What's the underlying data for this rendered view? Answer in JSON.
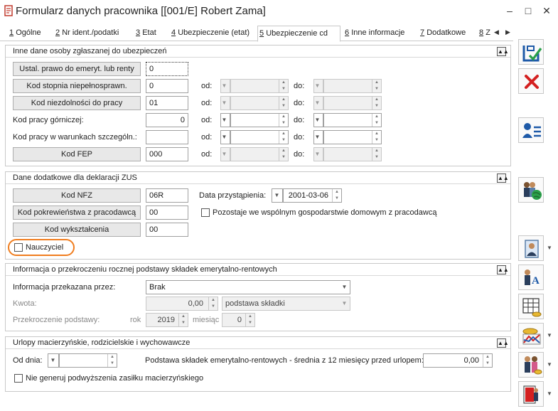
{
  "window": {
    "title": "Formularz danych pracownika [[001/E] Robert Zama]",
    "minimize": "–",
    "maximize": "□",
    "close": "✕"
  },
  "tabs": [
    {
      "num": "1",
      "label": "Ogólne"
    },
    {
      "num": "2",
      "label": "Nr ident./podatki"
    },
    {
      "num": "3",
      "label": "Etat"
    },
    {
      "num": "4",
      "label": "Ubezpieczenie (etat)"
    },
    {
      "num": "5",
      "label": "Ubezpieczenie cd"
    },
    {
      "num": "6",
      "label": "Inne informacje"
    },
    {
      "num": "7",
      "label": "Dodatkowe"
    },
    {
      "num": "8",
      "label": "Z"
    }
  ],
  "section1": {
    "title": "Inne dane osoby zgłaszanej do ubezpieczeń",
    "emeryt_button": "Ustal. prawo do emeryt. lub renty",
    "emeryt_value": "0",
    "niepelnospr_button": "Kod stopnia niepełnosprawn.",
    "niepelnospr_value": "0",
    "niezdolnosc_button": "Kod niezdolności do pracy",
    "niezdolnosc_value": "01",
    "gornicza_label": "Kod pracy górniczej:",
    "gornicza_value": "0",
    "szczegolne_label": "Kod pracy w warunkach szczególn.:",
    "szczegolne_value": "",
    "fep_button": "Kod FEP",
    "fep_value": "000",
    "od": "od:",
    "do": "do:"
  },
  "section2": {
    "title": "Dane dodatkowe dla deklaracji ZUS",
    "nfz_button": "Kod NFZ",
    "nfz_value": "06R",
    "data_label": "Data przystąpienia:",
    "data_value": "2001-03-06",
    "pokrew_button": "Kod pokrewieństwa z pracodawcą",
    "pokrew_value": "00",
    "gosp_label": "Pozostaje we wspólnym gospodarstwie domowym z pracodawcą",
    "wykszt_button": "Kod wykształcenia",
    "wykszt_value": "00",
    "nauczyciel_label": "Nauczyciel"
  },
  "section3": {
    "title": "Informacja o przekroczeniu rocznej podstawy składek emerytalno-rentowych",
    "info_label": "Informacja przekazana przez:",
    "info_value": "Brak",
    "kwota_label": "Kwota:",
    "kwota_value": "0,00",
    "kwota_type": "podstawa składki",
    "przekr_label": "Przekroczenie podstawy:",
    "rok_label": "rok",
    "rok_value": "2019",
    "miesiac_label": "miesiąc",
    "miesiac_value": "0"
  },
  "section4": {
    "title": "Urlopy macierzyńskie, rodzicielskie i wychowawcze",
    "od_dnia_label": "Od dnia:",
    "podstawa_label": "Podstawa składek emerytalno-rentowych - średnia z 12 miesięcy przed urlopem:",
    "podstawa_value": "0,00",
    "zasilek_label": "Nie generuj podwyższenia zasiłku macierzyńskiego"
  },
  "colors": {
    "accent_highlight": "#f07d1e",
    "save_icon": "#1e5aa8",
    "cancel_icon": "#d42020"
  }
}
